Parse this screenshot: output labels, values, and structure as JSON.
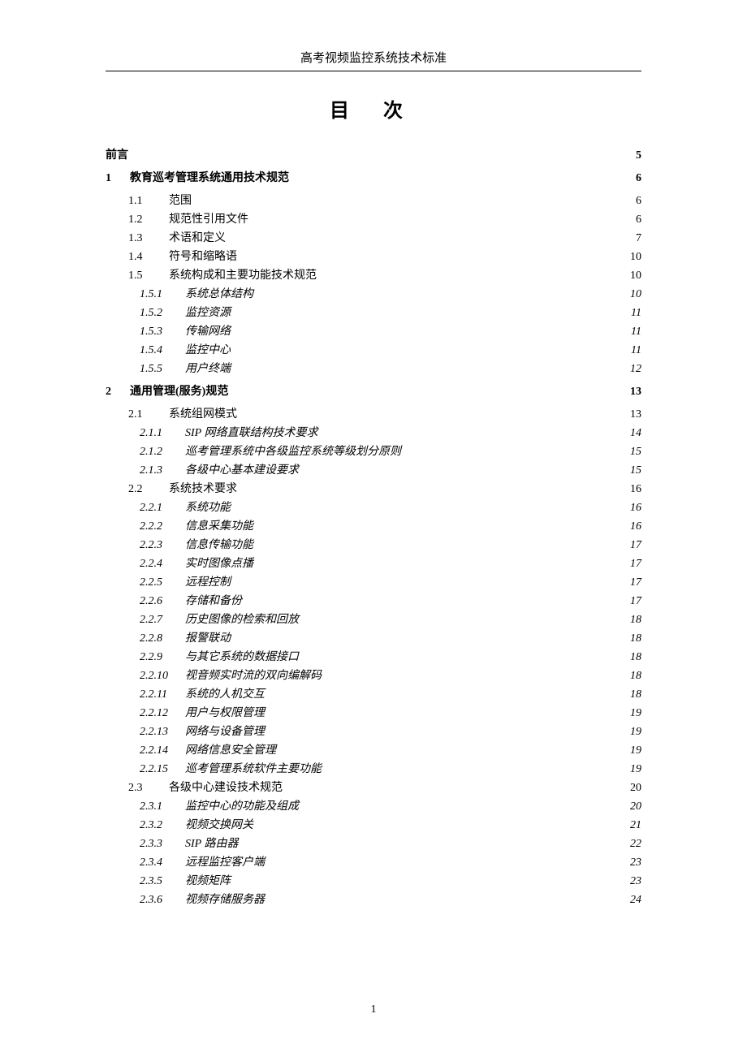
{
  "header": "高考视频监控系统技术标准",
  "toc_title": "目 次",
  "page_number": "1",
  "entries": [
    {
      "level": 0,
      "num": "",
      "label": "前言",
      "page": "5"
    },
    {
      "level": 1,
      "num": "1",
      "label": "教育巡考管理系统通用技术规范",
      "page": "6"
    },
    {
      "level": 2,
      "num": "1.1",
      "label": "范围",
      "page": "6"
    },
    {
      "level": 2,
      "num": "1.2",
      "label": "规范性引用文件",
      "page": "6"
    },
    {
      "level": 2,
      "num": "1.3",
      "label": "术语和定义",
      "page": "7"
    },
    {
      "level": 2,
      "num": "1.4",
      "label": "符号和缩略语",
      "page": "10"
    },
    {
      "level": 2,
      "num": "1.5",
      "label": "系统构成和主要功能技术规范",
      "page": "10"
    },
    {
      "level": 3,
      "num": "1.5.1",
      "label": "系统总体结构",
      "page": "10"
    },
    {
      "level": 3,
      "num": "1.5.2",
      "label": "监控资源",
      "page": "11"
    },
    {
      "level": 3,
      "num": "1.5.3",
      "label": "传输网络",
      "page": "11"
    },
    {
      "level": 3,
      "num": "1.5.4",
      "label": "监控中心",
      "page": "11"
    },
    {
      "level": 3,
      "num": "1.5.5",
      "label": "用户终端",
      "page": "12"
    },
    {
      "level": 1,
      "num": "2",
      "label": "通用管理(服务)规范",
      "page": "13"
    },
    {
      "level": 2,
      "num": "2.1",
      "label": "系统组网模式",
      "page": "13"
    },
    {
      "level": 3,
      "num": "2.1.1",
      "label": "SIP 网络直联结构技术要求",
      "page": "14"
    },
    {
      "level": 3,
      "num": "2.1.2",
      "label": "巡考管理系统中各级监控系统等级划分原则",
      "page": "15"
    },
    {
      "level": 3,
      "num": "2.1.3",
      "label": "各级中心基本建设要求",
      "page": "15"
    },
    {
      "level": 2,
      "num": "2.2",
      "label": "系统技术要求",
      "page": "16"
    },
    {
      "level": 3,
      "num": "2.2.1",
      "label": "系统功能",
      "page": "16"
    },
    {
      "level": 3,
      "num": "2.2.2",
      "label": "信息采集功能",
      "page": "16"
    },
    {
      "level": 3,
      "num": "2.2.3",
      "label": "信息传输功能",
      "page": "17"
    },
    {
      "level": 3,
      "num": "2.2.4",
      "label": "实时图像点播",
      "page": "17"
    },
    {
      "level": 3,
      "num": "2.2.5",
      "label": "远程控制",
      "page": "17"
    },
    {
      "level": 3,
      "num": "2.2.6",
      "label": "存储和备份",
      "page": "17"
    },
    {
      "level": 3,
      "num": "2.2.7",
      "label": "历史图像的检索和回放",
      "page": "18"
    },
    {
      "level": 3,
      "num": "2.2.8",
      "label": "报警联动",
      "page": "18"
    },
    {
      "level": 3,
      "num": "2.2.9",
      "label": "与其它系统的数据接口",
      "page": "18"
    },
    {
      "level": 3,
      "num": "2.2.10",
      "label": "视音频实时流的双向编解码",
      "page": "18"
    },
    {
      "level": 3,
      "num": "2.2.11",
      "label": "系统的人机交互",
      "page": "18"
    },
    {
      "level": 3,
      "num": "2.2.12",
      "label": "用户与权限管理",
      "page": "19"
    },
    {
      "level": 3,
      "num": "2.2.13",
      "label": "网络与设备管理",
      "page": "19"
    },
    {
      "level": 3,
      "num": "2.2.14",
      "label": "网络信息安全管理",
      "page": "19"
    },
    {
      "level": 3,
      "num": "2.2.15",
      "label": "巡考管理系统软件主要功能",
      "page": "19"
    },
    {
      "level": 2,
      "num": "2.3",
      "label": "各级中心建设技术规范",
      "page": "20"
    },
    {
      "level": 3,
      "num": "2.3.1",
      "label": "监控中心的功能及组成",
      "page": "20"
    },
    {
      "level": 3,
      "num": "2.3.2",
      "label": "视频交换网关",
      "page": "21"
    },
    {
      "level": 3,
      "num": "2.3.3",
      "label": "SIP 路由器",
      "page": "22"
    },
    {
      "level": 3,
      "num": "2.3.4",
      "label": "远程监控客户端",
      "page": "23"
    },
    {
      "level": 3,
      "num": "2.3.5",
      "label": "视频矩阵",
      "page": "23"
    },
    {
      "level": 3,
      "num": "2.3.6",
      "label": "视频存储服务器",
      "page": "24"
    }
  ]
}
